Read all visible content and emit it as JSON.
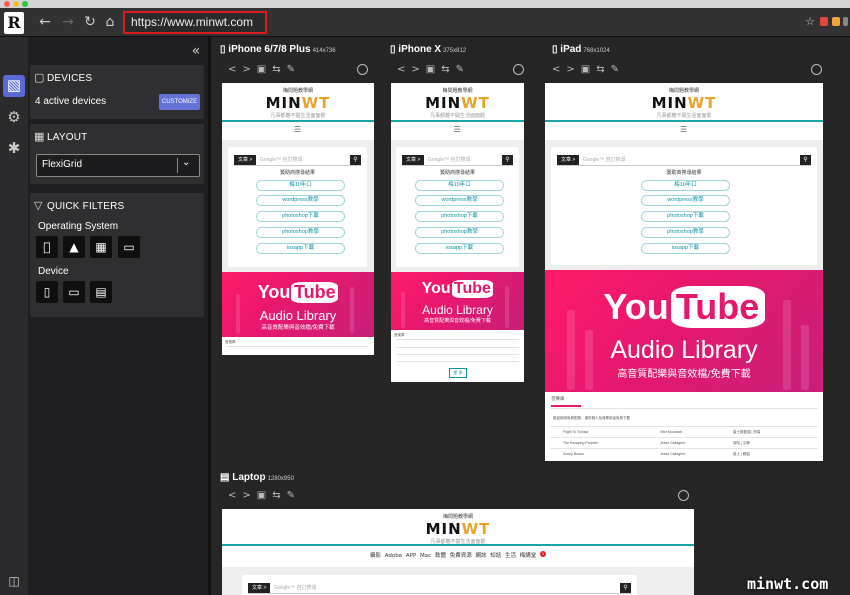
{
  "browser": {
    "url": "https://www.minwt.com",
    "app_logo": "R"
  },
  "sidebar": {
    "devices": {
      "title": "DEVICES",
      "count_text": "4 active devices",
      "customize_label": "CUSTOMIZE"
    },
    "layout": {
      "title": "LAYOUT",
      "selected": "FlexiGrid"
    },
    "filters": {
      "title": "QUICK FILTERS",
      "os_label": "Operating System",
      "device_label": "Device"
    }
  },
  "previews": [
    {
      "name": "iPhone 6/7/8 Plus",
      "size": "414x736"
    },
    {
      "name": "iPhone X",
      "size": "375x812"
    },
    {
      "name": "iPad",
      "size": "768x1024"
    },
    {
      "name": "Laptop",
      "size": "1280x950"
    }
  ],
  "site": {
    "logo_top": "梅問題教學網",
    "logo_main": "MINWT",
    "logo_sub": "凡事都離不開生活面面觀",
    "search_label": "文章 >",
    "search_placeholder": "Google™ 自訂搜尋",
    "sponsor_title": "贊助商搜尋結果",
    "keywords": [
      "梅10年口",
      "wordpress教學",
      "photoshop下載",
      "photoshop教學",
      "iosapp下載"
    ],
    "yt_you": "You",
    "yt_tube": "Tube",
    "yt_library": "Audio Library",
    "yt_cn": "高音質配樂與音效檔/免費下載",
    "laptop_menu": [
      "攝影",
      "Adobe",
      "APP",
      "Mac",
      "軟體",
      "免費資源",
      "網誌",
      "知話",
      "生活",
      "梅講堂"
    ],
    "badge": "1",
    "tab_label": "音樂庫",
    "table_hint": "歡迎使用免費配樂，僅供個人及商業用途免費下載",
    "tracks": [
      "Flight To Tunisia",
      "The Escaping Prophet",
      "Sunny Bossa"
    ],
    "track_artists": [
      "Vibe Mountain",
      "Jesse Gallagher",
      "Jesse Gallagher"
    ],
    "track_genres": [
      "爵士與藍調 | 悲傷",
      "嘻哈 | 平靜",
      "爵士 | 輕鬆"
    ],
    "update_btn": "更 多"
  },
  "watermark": "minwt.com",
  "colors": {
    "accent": "#6473d8",
    "url_highlight": "#d81b1b",
    "teal": "#1aa5a5",
    "youtube_pink": "#e6186d"
  }
}
